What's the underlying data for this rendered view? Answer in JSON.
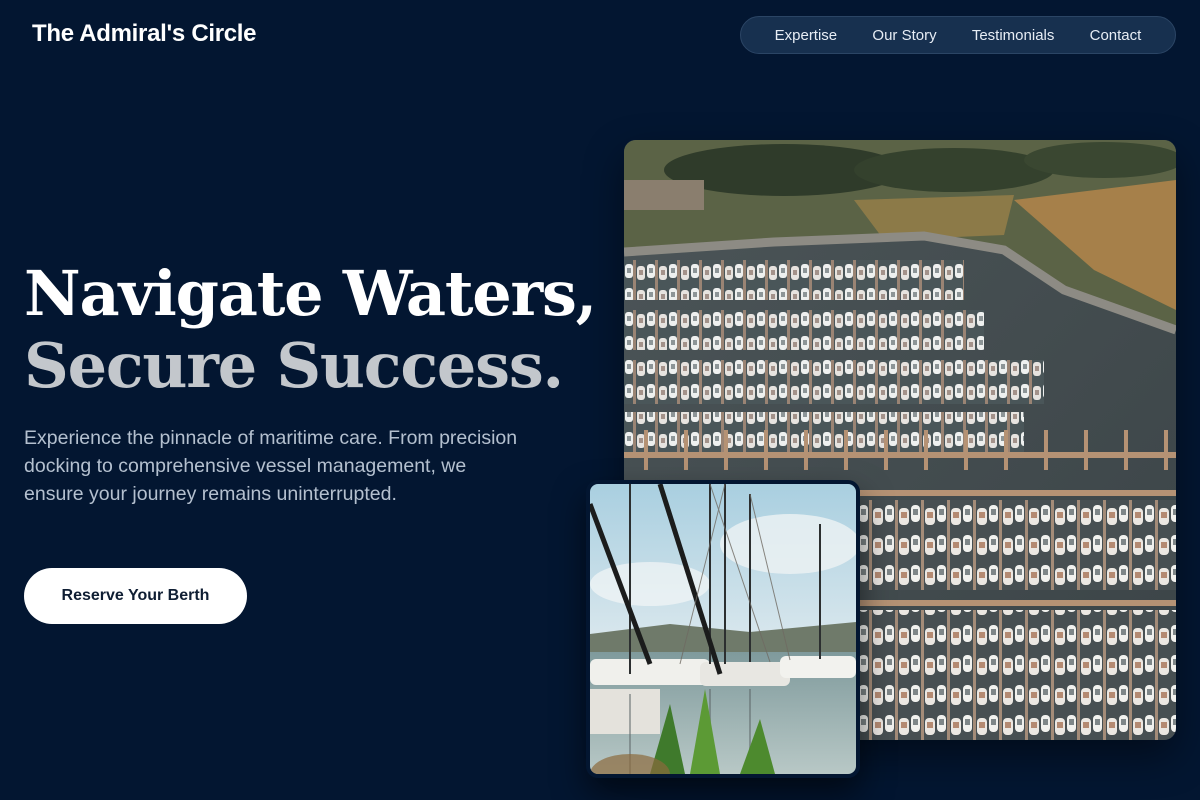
{
  "header": {
    "brand": "The Admiral's Circle",
    "nav": [
      "Expertise",
      "Our Story",
      "Testimonials",
      "Contact"
    ]
  },
  "hero": {
    "title_line1": "Navigate Waters,",
    "title_line2": "Secure Success.",
    "description": "Experience the pinnacle of maritime care. From precision docking to comprehensive vessel management, we ensure your journey remains uninterrupted.",
    "cta_label": "Reserve Your Berth"
  },
  "colors": {
    "background": "#031631",
    "nav_pill": "#17304f",
    "title_primary": "#ffffff",
    "title_secondary": "#c3c7cc",
    "body_text": "#b4c0cf",
    "button_bg": "#ffffff",
    "button_text": "#0f1e33"
  },
  "images": {
    "main": "aerial-marina-photo",
    "inset": "sailboat-masts-photo"
  }
}
